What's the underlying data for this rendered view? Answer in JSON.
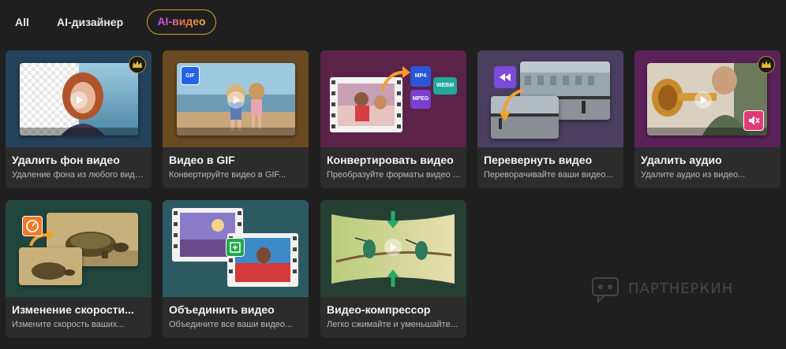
{
  "tabs": [
    {
      "label": "All",
      "active": false
    },
    {
      "label": "AI-дизайнер",
      "active": false
    },
    {
      "label": "AI-видео",
      "active": true
    }
  ],
  "cards": [
    {
      "title": "Удалить фон видео",
      "desc": "Удаление фона из любого виде...",
      "premium": true,
      "bg": "#24425c"
    },
    {
      "title": "Видео в GIF",
      "desc": "Конвертируйте видео в GIF...",
      "premium": false,
      "bg": "#6a4a22",
      "badge": "GIF"
    },
    {
      "title": "Конвертировать видео",
      "desc": "Преобразуйте форматы видео ...",
      "premium": false,
      "bg": "#5c2348",
      "badges": [
        "MP4",
        "WEBM",
        "MPEG"
      ]
    },
    {
      "title": "Перевернуть видео",
      "desc": "Переворачивайте ваши видео...",
      "premium": false,
      "bg": "#4a3f60"
    },
    {
      "title": "Удалить аудио",
      "desc": "Удалите аудио из видео...",
      "premium": true,
      "bg": "#5b2259"
    },
    {
      "title": "Изменение скорости...",
      "desc": "Измените скорость ваших...",
      "premium": false,
      "bg": "#22463e"
    },
    {
      "title": "Объединить видео",
      "desc": "Объедините все ваши видео...",
      "premium": false,
      "bg": "#2d5a62"
    },
    {
      "title": "Видео-компрессор",
      "desc": "Легко сжимайте и уменьшайте...",
      "premium": false,
      "bg": "#253f33"
    }
  ],
  "watermark": "ПАРТНЕРКИН",
  "colors": {
    "accent_gold": "#d4a826",
    "card_bg": "#2c2c2c",
    "page_bg": "#1f1f1f"
  }
}
